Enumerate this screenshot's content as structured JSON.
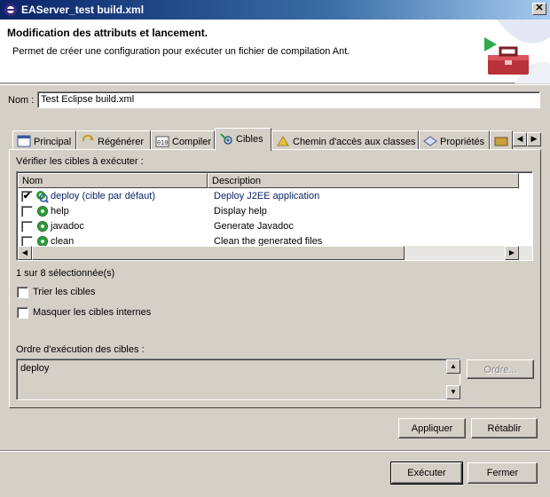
{
  "window": {
    "title": "EAServer_test build.xml",
    "close_glyph": "✕"
  },
  "banner": {
    "heading": "Modification des attributs et lancement.",
    "description": "Permet de créer une configuration pour exécuter un fichier de compilation Ant."
  },
  "name": {
    "label": "Nom :",
    "value": "Test Eclipse build.xml"
  },
  "tabs": [
    {
      "label": "Principal",
      "icon": "main-tab-icon"
    },
    {
      "label": "Régénérer",
      "icon": "refresh-icon"
    },
    {
      "label": "Compiler",
      "icon": "build-icon"
    },
    {
      "label": "Cibles",
      "icon": "targets-icon",
      "active": true
    },
    {
      "label": "Chemin d'accès aux classes",
      "icon": "classpath-icon"
    },
    {
      "label": "Propriétés",
      "icon": "properties-icon"
    }
  ],
  "targets": {
    "label": "Vérifier les cibles à exécuter :",
    "columns": [
      "Nom",
      "Description"
    ],
    "rows": [
      {
        "checked": true,
        "name": "deploy (cible par défaut)",
        "description": "Deploy J2EE application"
      },
      {
        "checked": false,
        "name": "help",
        "description": "Display help"
      },
      {
        "checked": false,
        "name": "javadoc",
        "description": "Generate Javadoc"
      },
      {
        "checked": false,
        "name": "clean",
        "description": "Clean the generated files"
      }
    ],
    "selection_count": "1 sur 8 sélectionnée(s)",
    "sort_label": "Trier les cibles",
    "hide_internal_label": "Masquer les cibles internes"
  },
  "order": {
    "label": "Ordre d'exécution des cibles :",
    "items": [
      "deploy"
    ],
    "button": "Ordre..."
  },
  "buttons": {
    "apply": "Appliquer",
    "revert": "Rétablir",
    "run": "Exécuter",
    "close": "Fermer"
  },
  "colors": {
    "title_start": "#0a246a",
    "title_end": "#a6caf0",
    "selection_text": "#0a246a",
    "target_green": "#2e9a3a"
  }
}
